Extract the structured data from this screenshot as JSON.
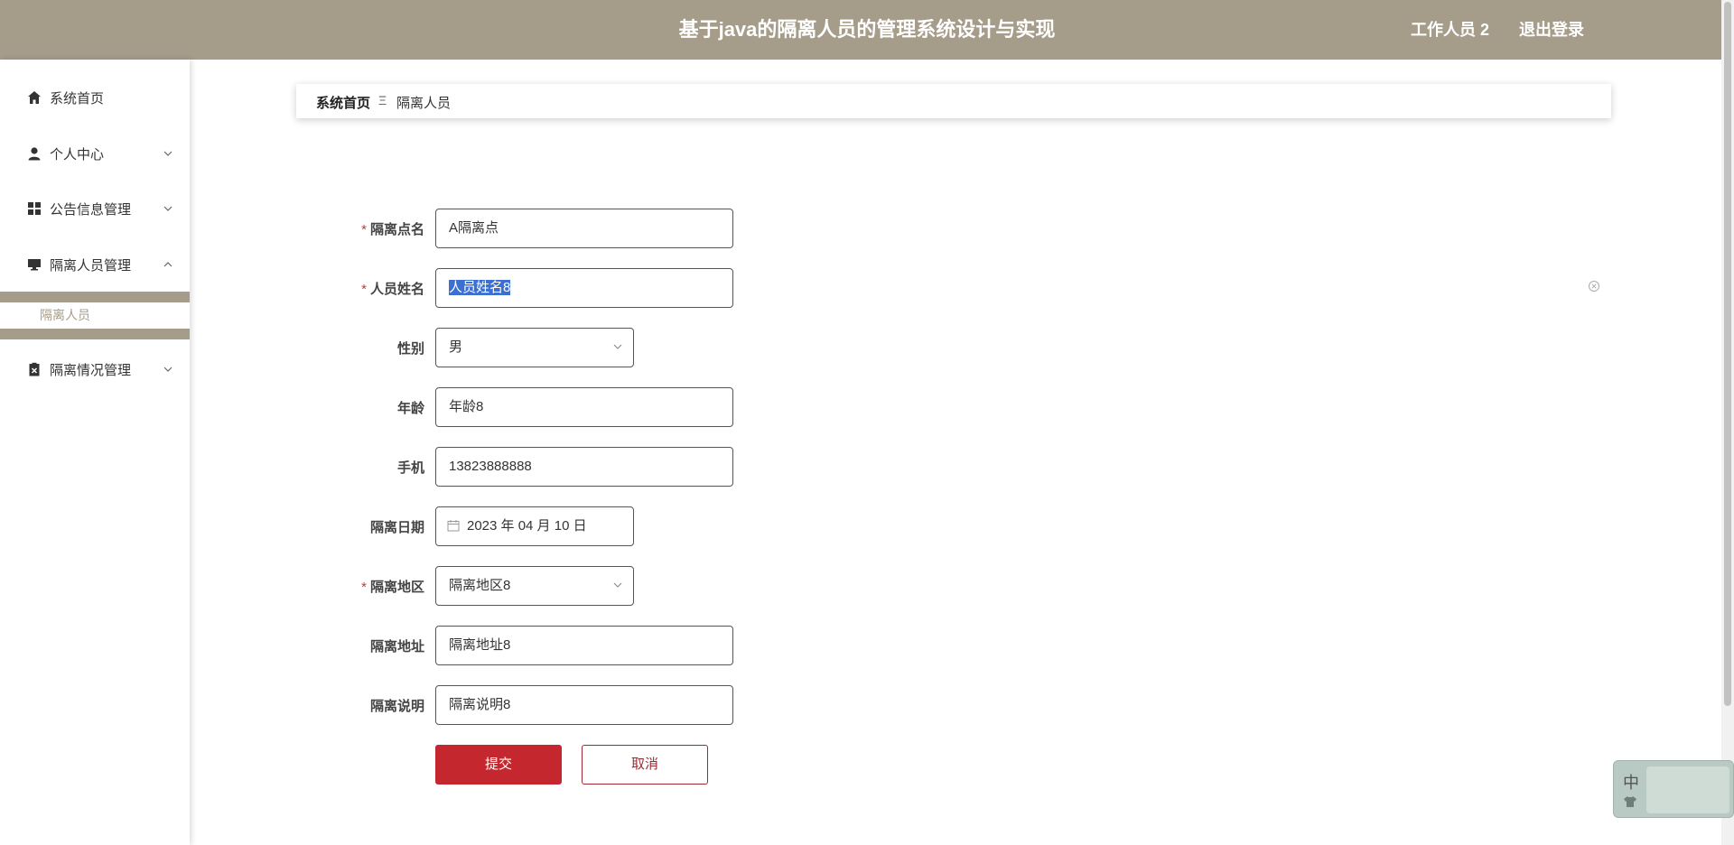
{
  "header": {
    "title": "基于java的隔离人员的管理系统设计与实现",
    "user": "工作人员 2",
    "logout": "退出登录"
  },
  "sidebar": {
    "items": [
      {
        "label": "系统首页",
        "icon": "home-icon"
      },
      {
        "label": "个人中心",
        "icon": "user-icon"
      },
      {
        "label": "公告信息管理",
        "icon": "grid-icon"
      },
      {
        "label": "隔离人员管理",
        "icon": "monitor-icon"
      },
      {
        "label": "隔离情况管理",
        "icon": "clipboard-icon"
      }
    ],
    "subitem": "隔离人员"
  },
  "breadcrumb": {
    "home": "系统首页",
    "separator": "Ξ",
    "current": "隔离人员"
  },
  "form": {
    "site_name": {
      "label": "隔离点名",
      "value": "A隔离点",
      "required": true
    },
    "person_name": {
      "label": "人员姓名",
      "value": "人员姓名8",
      "required": true
    },
    "gender": {
      "label": "性别",
      "value": "男"
    },
    "age": {
      "label": "年龄",
      "value": "年龄8"
    },
    "phone": {
      "label": "手机",
      "value": "13823888888"
    },
    "date": {
      "label": "隔离日期",
      "value": "2023 年 04 月 10 日"
    },
    "region": {
      "label": "隔离地区",
      "value": "隔离地区8",
      "required": true
    },
    "address": {
      "label": "隔离地址",
      "value": "隔离地址8"
    },
    "description": {
      "label": "隔离说明",
      "value": "隔离说明8"
    }
  },
  "buttons": {
    "submit": "提交",
    "cancel": "取消"
  },
  "ime": {
    "char": "中"
  },
  "colors": {
    "header_bg": "#a69c8a",
    "primary": "#c4272e",
    "required": "#d0333b"
  }
}
